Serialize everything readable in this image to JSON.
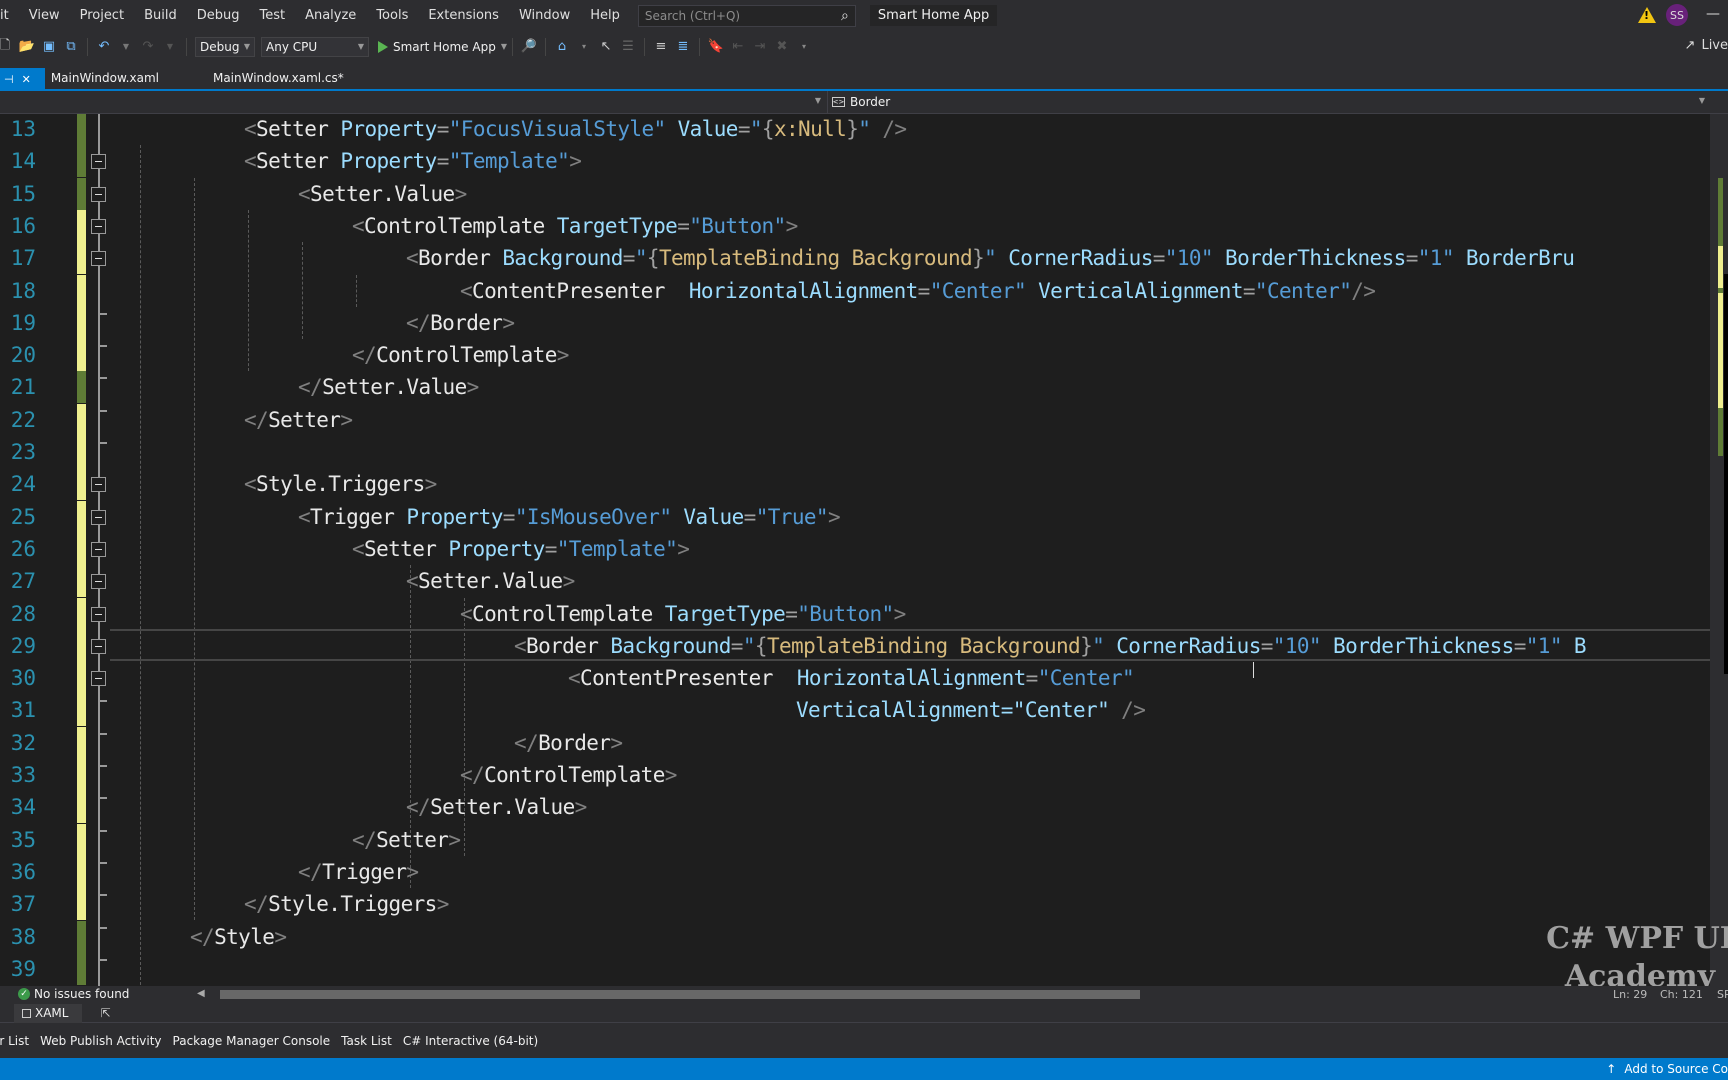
{
  "menu": {
    "items": [
      "it",
      "View",
      "Project",
      "Build",
      "Debug",
      "Test",
      "Analyze",
      "Tools",
      "Extensions",
      "Window",
      "Help"
    ],
    "search_placeholder": "Search (Ctrl+Q)",
    "app_title": "Smart Home App",
    "avatar_initials": "SS",
    "warning_icon": "warning-icon"
  },
  "toolbar": {
    "config": "Debug",
    "platform": "Any CPU",
    "run_target": "Smart Home App",
    "live_share": "Live"
  },
  "tabs": [
    {
      "label": "MainWindow.xaml",
      "active": true
    },
    {
      "label": "MainWindow.xaml.cs*",
      "active": false
    }
  ],
  "navbar": {
    "element": "Border"
  },
  "editor": {
    "current_line": 29,
    "lines": [
      {
        "n": 13,
        "change": "saved",
        "fold": false,
        "text": "<Setter Property=\"FocusVisualStyle\" Value=\"{x:Null}\" />"
      },
      {
        "n": 14,
        "change": "saved",
        "fold": true,
        "text": "<Setter Property=\"Template\">"
      },
      {
        "n": 15,
        "change": "saved",
        "fold": true,
        "text": "<Setter.Value>"
      },
      {
        "n": 16,
        "change": "unsaved",
        "fold": true,
        "text": "<ControlTemplate TargetType=\"Button\">"
      },
      {
        "n": 17,
        "change": "unsaved",
        "fold": true,
        "text": "<Border Background=\"{TemplateBinding Background}\" CornerRadius=\"10\" BorderThickness=\"1\" BorderBru"
      },
      {
        "n": 18,
        "change": "unsaved",
        "fold": false,
        "text": "<ContentPresenter  HorizontalAlignment=\"Center\" VerticalAlignment=\"Center\"/>"
      },
      {
        "n": 19,
        "change": "unsaved",
        "fold": false,
        "text": "</Border>"
      },
      {
        "n": 20,
        "change": "unsaved",
        "fold": false,
        "text": "</ControlTemplate>"
      },
      {
        "n": 21,
        "change": "saved",
        "fold": false,
        "text": "</Setter.Value>"
      },
      {
        "n": 22,
        "change": "unsaved",
        "fold": false,
        "text": "</Setter>"
      },
      {
        "n": 23,
        "change": "unsaved",
        "fold": false,
        "text": ""
      },
      {
        "n": 24,
        "change": "unsaved",
        "fold": true,
        "text": "<Style.Triggers>"
      },
      {
        "n": 25,
        "change": "unsaved",
        "fold": true,
        "text": "<Trigger Property=\"IsMouseOver\" Value=\"True\">"
      },
      {
        "n": 26,
        "change": "unsaved",
        "fold": true,
        "text": "<Setter Property=\"Template\">"
      },
      {
        "n": 27,
        "change": "unsaved",
        "fold": true,
        "text": "<Setter.Value>"
      },
      {
        "n": 28,
        "change": "unsaved",
        "fold": true,
        "text": "<ControlTemplate TargetType=\"Button\">"
      },
      {
        "n": 29,
        "change": "unsaved",
        "fold": true,
        "text": "<Border Background=\"{TemplateBinding Background}\" CornerRadius=\"10\" BorderThickness=\"1\" B"
      },
      {
        "n": 30,
        "change": "unsaved",
        "fold": true,
        "text": "<ContentPresenter  HorizontalAlignment=\"Center\""
      },
      {
        "n": 31,
        "change": "unsaved",
        "fold": false,
        "text": "VerticalAlignment=\"Center\" />"
      },
      {
        "n": 32,
        "change": "unsaved",
        "fold": false,
        "text": "</Border>"
      },
      {
        "n": 33,
        "change": "unsaved",
        "fold": false,
        "text": "</ControlTemplate>"
      },
      {
        "n": 34,
        "change": "unsaved",
        "fold": false,
        "text": "</Setter.Value>"
      },
      {
        "n": 35,
        "change": "unsaved",
        "fold": false,
        "text": "</Setter>"
      },
      {
        "n": 36,
        "change": "unsaved",
        "fold": false,
        "text": "</Trigger>"
      },
      {
        "n": 37,
        "change": "unsaved",
        "fold": false,
        "text": "</Style.Triggers>"
      },
      {
        "n": 38,
        "change": "saved",
        "fold": false,
        "text": "</Style>"
      },
      {
        "n": 39,
        "change": "saved",
        "fold": false,
        "text": ""
      }
    ]
  },
  "status": {
    "issues": "No issues found",
    "ln": "Ln: 29",
    "ch": "Ch: 121",
    "extra": "SP"
  },
  "xaml_tab": "XAML",
  "bottom_tabs": [
    "or List",
    "Web Publish Activity",
    "Package Manager Console",
    "Task List",
    "C# Interactive (64-bit)"
  ],
  "bluebar": {
    "source_control": "Add to Source Co"
  },
  "watermark": {
    "line1": "C# WPF UI",
    "line2": "Academy"
  },
  "colors": {
    "accent": "#007acc",
    "change_saved": "#5f7c36",
    "change_unsaved": "#efef8f",
    "line_number": "#2b91af"
  }
}
